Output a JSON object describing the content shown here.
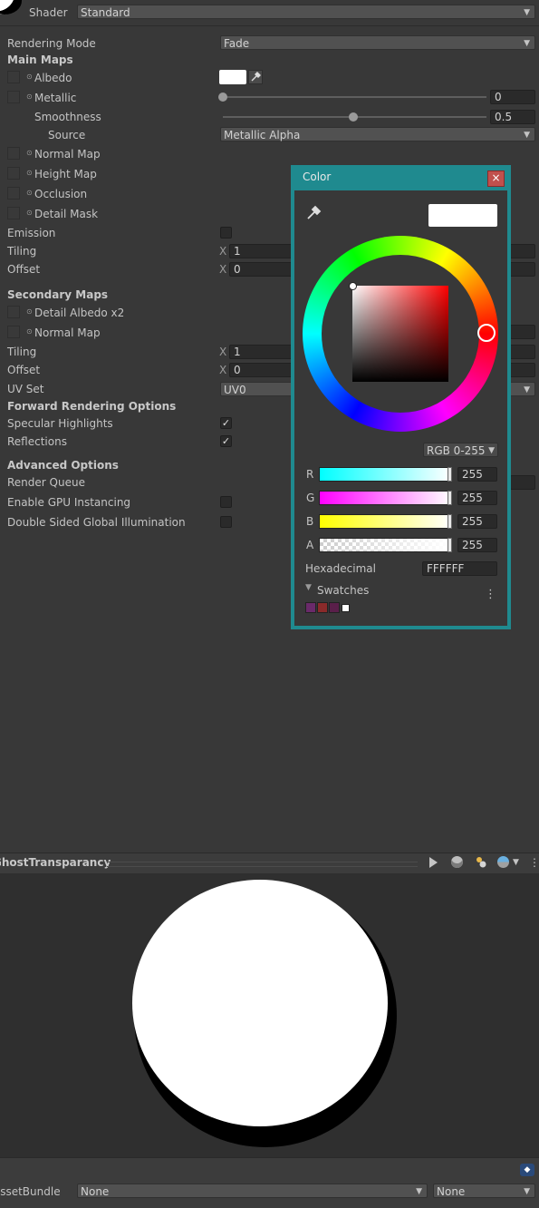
{
  "shader": {
    "label": "Shader",
    "value": "Standard"
  },
  "rendering_mode": {
    "label": "Rendering Mode",
    "value": "Fade"
  },
  "main_maps": {
    "title": "Main Maps",
    "albedo": "Albedo",
    "metallic": {
      "label": "Metallic",
      "value": "0",
      "fraction": 0
    },
    "smoothness": {
      "label": "Smoothness",
      "value": "0.5",
      "fraction": 0.5
    },
    "source": {
      "label": "Source",
      "value": "Metallic Alpha"
    },
    "normal_map": "Normal Map",
    "height_map": "Height Map",
    "occlusion": "Occlusion",
    "detail_mask": "Detail Mask",
    "emission": "Emission",
    "tiling": {
      "label": "Tiling",
      "axis": "X",
      "value": "1"
    },
    "offset": {
      "label": "Offset",
      "axis": "X",
      "value": "0"
    }
  },
  "secondary_maps": {
    "title": "Secondary Maps",
    "detail_albedo": "Detail Albedo x2",
    "normal_map": "Normal Map",
    "tiling": {
      "label": "Tiling",
      "axis": "X",
      "value": "1"
    },
    "offset": {
      "label": "Offset",
      "axis": "X",
      "value": "0"
    },
    "uv_set": {
      "label": "UV Set",
      "value": "UV0"
    }
  },
  "forward": {
    "title": "Forward Rendering Options",
    "specular": "Specular Highlights",
    "reflections": "Reflections",
    "specular_checked": true,
    "reflections_checked": true,
    "check_mark": "✓"
  },
  "advanced": {
    "title": "Advanced Options",
    "render_queue": "Render Queue",
    "gpu_instancing": "Enable GPU Instancing",
    "double_sided_gi": "Double Sided Global Illumination"
  },
  "color_window": {
    "title": "Color",
    "close": "×",
    "mode": "RGB 0-255",
    "channels": [
      {
        "label": "R",
        "value": "255"
      },
      {
        "label": "G",
        "value": "255"
      },
      {
        "label": "B",
        "value": "255"
      },
      {
        "label": "A",
        "value": "255"
      }
    ],
    "hex_label": "Hexadecimal",
    "hex_value": "FFFFFF",
    "swatches_label": "Swatches",
    "swatch_colors": [
      "#6a2a6a",
      "#8a2a2a",
      "#5a1f4a",
      "#ffffff"
    ],
    "menu_icon": "⋮"
  },
  "preview": {
    "title": "GhostTransparancy"
  },
  "asset_bundle": {
    "label": "AssetBundle",
    "value1": "None",
    "value2": "None"
  },
  "colors": {
    "accent": "#1f8a8f",
    "close": "#c0504d"
  }
}
